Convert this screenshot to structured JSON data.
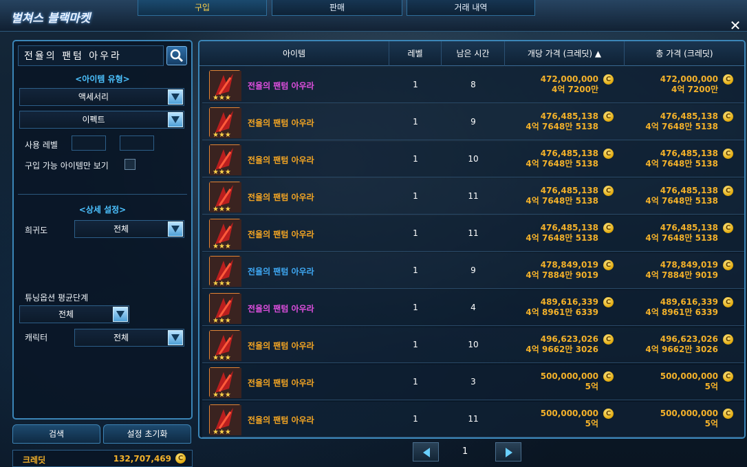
{
  "window": {
    "title": "벌쳐스 블랙마켓",
    "tabs": [
      {
        "label": "구입",
        "active": true
      },
      {
        "label": "판매",
        "active": false
      },
      {
        "label": "거래 내역",
        "active": false
      }
    ]
  },
  "filters": {
    "search_value": "전율의 팬텀 아우라",
    "item_type_title": "<아이템 유형>",
    "item_type": "액세서리",
    "item_subtype": "이펙트",
    "use_level_label": "사용 레벨",
    "buyable_only_label": "구입 가능 아이템만 보기",
    "detail_title": "<상세 설정>",
    "rarity_label": "희귀도",
    "rarity_value": "전체",
    "tuning_label": "튜닝옵션 평균단계",
    "tuning_value": "전체",
    "character_label": "캐릭터",
    "character_value": "전체",
    "search_button": "검색",
    "reset_button": "설정 초기화"
  },
  "credit": {
    "label": "크레딧",
    "amount": "132,707,469",
    "coin_symbol": "C"
  },
  "table": {
    "headers": [
      "아이템",
      "레벨",
      "남은 시간",
      "개당 가격 (크레딧) ▲",
      "총 가격 (크레딧)"
    ],
    "rows": [
      {
        "name": "전율의 팬텀 아우라",
        "color": "#e04fe0",
        "level": "1",
        "time": "8",
        "unit_price": "472,000,000",
        "unit_kr": "4억 7200만",
        "total_price": "472,000,000",
        "total_kr": "4억 7200만"
      },
      {
        "name": "전율의 팬텀 아우라",
        "color": "#f5a623",
        "level": "1",
        "time": "9",
        "unit_price": "476,485,138",
        "unit_kr": "4억 7648만 5138",
        "total_price": "476,485,138",
        "total_kr": "4억 7648만 5138"
      },
      {
        "name": "전율의 팬텀 아우라",
        "color": "#f5a623",
        "level": "1",
        "time": "10",
        "unit_price": "476,485,138",
        "unit_kr": "4억 7648만 5138",
        "total_price": "476,485,138",
        "total_kr": "4억 7648만 5138"
      },
      {
        "name": "전율의 팬텀 아우라",
        "color": "#f5a623",
        "level": "1",
        "time": "11",
        "unit_price": "476,485,138",
        "unit_kr": "4억 7648만 5138",
        "total_price": "476,485,138",
        "total_kr": "4억 7648만 5138"
      },
      {
        "name": "전율의 팬텀 아우라",
        "color": "#f5a623",
        "level": "1",
        "time": "11",
        "unit_price": "476,485,138",
        "unit_kr": "4억 7648만 5138",
        "total_price": "476,485,138",
        "total_kr": "4억 7648만 5138"
      },
      {
        "name": "전율의 팬텀 아우라",
        "color": "#3fa9f5",
        "level": "1",
        "time": "9",
        "unit_price": "478,849,019",
        "unit_kr": "4억 7884만 9019",
        "total_price": "478,849,019",
        "total_kr": "4억 7884만 9019"
      },
      {
        "name": "전율의 팬텀 아우라",
        "color": "#e04fe0",
        "level": "1",
        "time": "4",
        "unit_price": "489,616,339",
        "unit_kr": "4억 8961만 6339",
        "total_price": "489,616,339",
        "total_kr": "4억 8961만 6339"
      },
      {
        "name": "전율의 팬텀 아우라",
        "color": "#f5a623",
        "level": "1",
        "time": "10",
        "unit_price": "496,623,026",
        "unit_kr": "4억 9662만 3026",
        "total_price": "496,623,026",
        "total_kr": "4억 9662만 3026"
      },
      {
        "name": "전율의 팬텀 아우라",
        "color": "#f5a623",
        "level": "1",
        "time": "3",
        "unit_price": "500,000,000",
        "unit_kr": "5억",
        "total_price": "500,000,000",
        "total_kr": "5억"
      },
      {
        "name": "전율의 팬텀 아우라",
        "color": "#f5a623",
        "level": "1",
        "time": "11",
        "unit_price": "500,000,000",
        "unit_kr": "5억",
        "total_price": "500,000,000",
        "total_kr": "5억"
      }
    ]
  },
  "pagination": {
    "page": "1"
  },
  "icons": {
    "close": "close-icon",
    "search": "magnifier-icon",
    "dropdown": "chevron-down-icon",
    "prev": "triangle-left-icon",
    "next": "triangle-right-icon",
    "coin": "credit-coin-icon"
  }
}
